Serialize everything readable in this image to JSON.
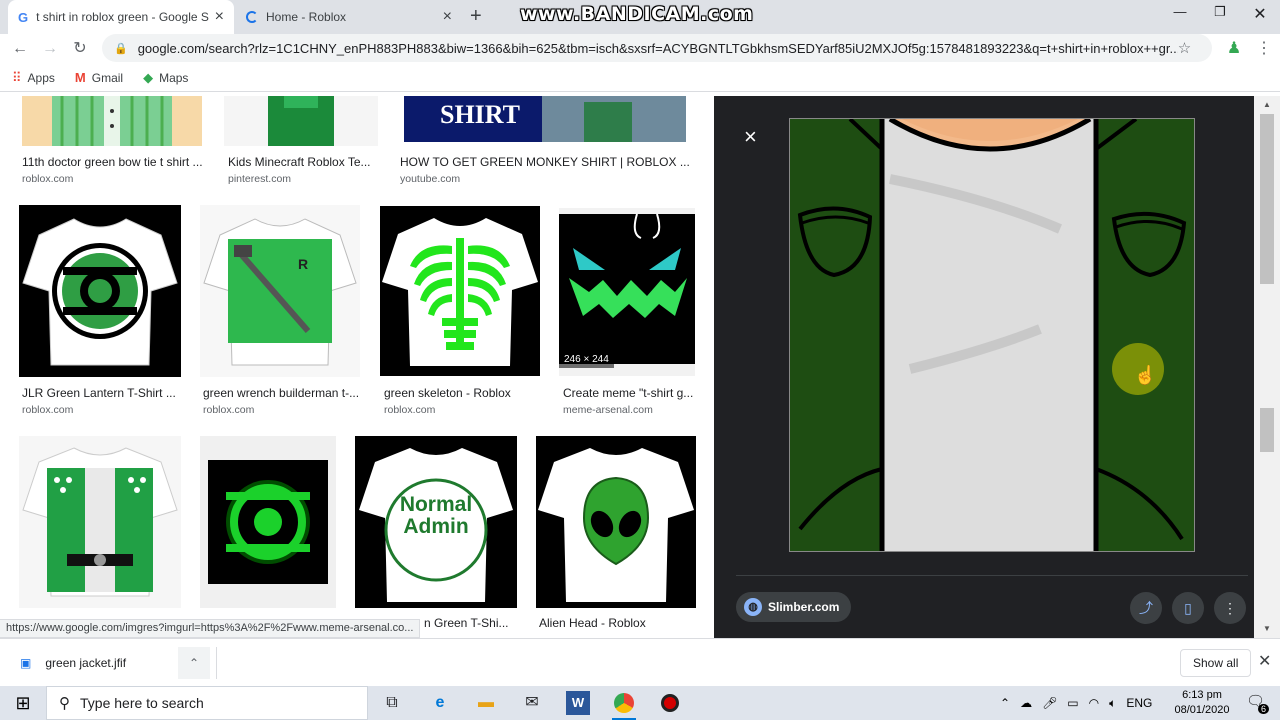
{
  "tabs": [
    {
      "title": "t shirt in roblox green - Google S",
      "favicon": "google-icon",
      "active": true
    },
    {
      "title": "Home - Roblox",
      "favicon": "loading-spinner-icon",
      "active": false
    }
  ],
  "watermark": "www.BANDICAM.com",
  "address_bar": {
    "url": "google.com/search?rlz=1C1CHNY_enPH883PH883&biw=1366&bih=625&tbm=isch&sxsrf=ACYBGNTLTGbkhsmSEDYarf85iU2MXJOf5g:1578481893223&q=t+shirt+in+roblox++gr..."
  },
  "bookmarks": [
    {
      "label": "Apps",
      "icon": "apps-grid-icon"
    },
    {
      "label": "Gmail",
      "icon": "gmail-icon"
    },
    {
      "label": "Maps",
      "icon": "maps-icon"
    }
  ],
  "results": {
    "top_row": [
      {
        "caption": "11th doctor green bow tie t shirt ...",
        "source": "roblox.com"
      },
      {
        "caption": "Kids Minecraft Roblox Te...",
        "source": "pinterest.com"
      },
      {
        "caption": "HOW TO GET GREEN MONKEY SHIRT | ROBLOX ...",
        "source": "youtube.com",
        "thumb_text": "SHIRT"
      }
    ],
    "middle_row": [
      {
        "caption": "JLR Green Lantern T-Shirt ...",
        "source": "roblox.com"
      },
      {
        "caption": "green wrench builderman t-...",
        "source": "roblox.com"
      },
      {
        "caption": "green skeleton - Roblox",
        "source": "roblox.com"
      },
      {
        "caption": "Create meme \"t-shirt g...",
        "source": "meme-arsenal.com",
        "dimensions": "246 × 244"
      }
    ],
    "bottom_row": [
      {
        "caption": "",
        "source": ""
      },
      {
        "caption": "",
        "source": ""
      },
      {
        "caption": "n Green T-Shi...",
        "source": "",
        "thumb_text_line1": "Normal",
        "thumb_text_line2": "Admin"
      },
      {
        "caption": "Alien Head - Roblox",
        "source": ""
      }
    ]
  },
  "panel": {
    "close_label": "×",
    "source_chip": "Slimber.com"
  },
  "status_url": "https://www.google.com/imgres?imgurl=https%3A%2F%2Fwww.meme-arsenal.co...",
  "downloads": {
    "file": "green jacket.jfif",
    "show_all": "Show all"
  },
  "taskbar": {
    "search_placeholder": "Type here to search",
    "language": "ENG",
    "time": "6:13 pm",
    "date": "08/01/2020",
    "notification_count": "6"
  }
}
